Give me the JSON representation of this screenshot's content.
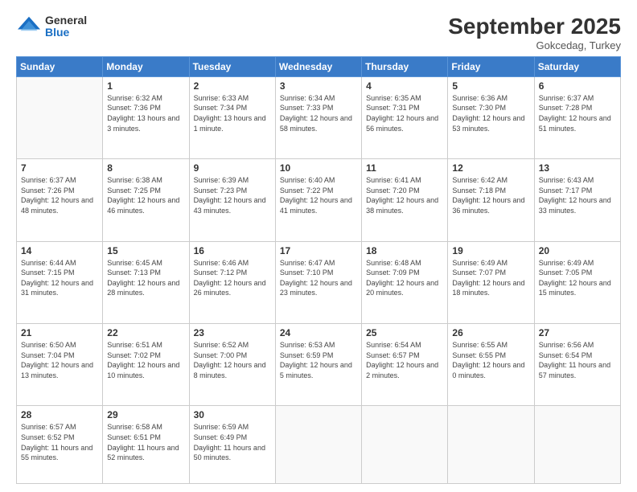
{
  "header": {
    "logo_general": "General",
    "logo_blue": "Blue",
    "month_title": "September 2025",
    "location": "Gokcedag, Turkey"
  },
  "weekdays": [
    "Sunday",
    "Monday",
    "Tuesday",
    "Wednesday",
    "Thursday",
    "Friday",
    "Saturday"
  ],
  "weeks": [
    [
      {
        "day": "",
        "sunrise": "",
        "sunset": "",
        "daylight": ""
      },
      {
        "day": "1",
        "sunrise": "Sunrise: 6:32 AM",
        "sunset": "Sunset: 7:36 PM",
        "daylight": "Daylight: 13 hours and 3 minutes."
      },
      {
        "day": "2",
        "sunrise": "Sunrise: 6:33 AM",
        "sunset": "Sunset: 7:34 PM",
        "daylight": "Daylight: 13 hours and 1 minute."
      },
      {
        "day": "3",
        "sunrise": "Sunrise: 6:34 AM",
        "sunset": "Sunset: 7:33 PM",
        "daylight": "Daylight: 12 hours and 58 minutes."
      },
      {
        "day": "4",
        "sunrise": "Sunrise: 6:35 AM",
        "sunset": "Sunset: 7:31 PM",
        "daylight": "Daylight: 12 hours and 56 minutes."
      },
      {
        "day": "5",
        "sunrise": "Sunrise: 6:36 AM",
        "sunset": "Sunset: 7:30 PM",
        "daylight": "Daylight: 12 hours and 53 minutes."
      },
      {
        "day": "6",
        "sunrise": "Sunrise: 6:37 AM",
        "sunset": "Sunset: 7:28 PM",
        "daylight": "Daylight: 12 hours and 51 minutes."
      }
    ],
    [
      {
        "day": "7",
        "sunrise": "Sunrise: 6:37 AM",
        "sunset": "Sunset: 7:26 PM",
        "daylight": "Daylight: 12 hours and 48 minutes."
      },
      {
        "day": "8",
        "sunrise": "Sunrise: 6:38 AM",
        "sunset": "Sunset: 7:25 PM",
        "daylight": "Daylight: 12 hours and 46 minutes."
      },
      {
        "day": "9",
        "sunrise": "Sunrise: 6:39 AM",
        "sunset": "Sunset: 7:23 PM",
        "daylight": "Daylight: 12 hours and 43 minutes."
      },
      {
        "day": "10",
        "sunrise": "Sunrise: 6:40 AM",
        "sunset": "Sunset: 7:22 PM",
        "daylight": "Daylight: 12 hours and 41 minutes."
      },
      {
        "day": "11",
        "sunrise": "Sunrise: 6:41 AM",
        "sunset": "Sunset: 7:20 PM",
        "daylight": "Daylight: 12 hours and 38 minutes."
      },
      {
        "day": "12",
        "sunrise": "Sunrise: 6:42 AM",
        "sunset": "Sunset: 7:18 PM",
        "daylight": "Daylight: 12 hours and 36 minutes."
      },
      {
        "day": "13",
        "sunrise": "Sunrise: 6:43 AM",
        "sunset": "Sunset: 7:17 PM",
        "daylight": "Daylight: 12 hours and 33 minutes."
      }
    ],
    [
      {
        "day": "14",
        "sunrise": "Sunrise: 6:44 AM",
        "sunset": "Sunset: 7:15 PM",
        "daylight": "Daylight: 12 hours and 31 minutes."
      },
      {
        "day": "15",
        "sunrise": "Sunrise: 6:45 AM",
        "sunset": "Sunset: 7:13 PM",
        "daylight": "Daylight: 12 hours and 28 minutes."
      },
      {
        "day": "16",
        "sunrise": "Sunrise: 6:46 AM",
        "sunset": "Sunset: 7:12 PM",
        "daylight": "Daylight: 12 hours and 26 minutes."
      },
      {
        "day": "17",
        "sunrise": "Sunrise: 6:47 AM",
        "sunset": "Sunset: 7:10 PM",
        "daylight": "Daylight: 12 hours and 23 minutes."
      },
      {
        "day": "18",
        "sunrise": "Sunrise: 6:48 AM",
        "sunset": "Sunset: 7:09 PM",
        "daylight": "Daylight: 12 hours and 20 minutes."
      },
      {
        "day": "19",
        "sunrise": "Sunrise: 6:49 AM",
        "sunset": "Sunset: 7:07 PM",
        "daylight": "Daylight: 12 hours and 18 minutes."
      },
      {
        "day": "20",
        "sunrise": "Sunrise: 6:49 AM",
        "sunset": "Sunset: 7:05 PM",
        "daylight": "Daylight: 12 hours and 15 minutes."
      }
    ],
    [
      {
        "day": "21",
        "sunrise": "Sunrise: 6:50 AM",
        "sunset": "Sunset: 7:04 PM",
        "daylight": "Daylight: 12 hours and 13 minutes."
      },
      {
        "day": "22",
        "sunrise": "Sunrise: 6:51 AM",
        "sunset": "Sunset: 7:02 PM",
        "daylight": "Daylight: 12 hours and 10 minutes."
      },
      {
        "day": "23",
        "sunrise": "Sunrise: 6:52 AM",
        "sunset": "Sunset: 7:00 PM",
        "daylight": "Daylight: 12 hours and 8 minutes."
      },
      {
        "day": "24",
        "sunrise": "Sunrise: 6:53 AM",
        "sunset": "Sunset: 6:59 PM",
        "daylight": "Daylight: 12 hours and 5 minutes."
      },
      {
        "day": "25",
        "sunrise": "Sunrise: 6:54 AM",
        "sunset": "Sunset: 6:57 PM",
        "daylight": "Daylight: 12 hours and 2 minutes."
      },
      {
        "day": "26",
        "sunrise": "Sunrise: 6:55 AM",
        "sunset": "Sunset: 6:55 PM",
        "daylight": "Daylight: 12 hours and 0 minutes."
      },
      {
        "day": "27",
        "sunrise": "Sunrise: 6:56 AM",
        "sunset": "Sunset: 6:54 PM",
        "daylight": "Daylight: 11 hours and 57 minutes."
      }
    ],
    [
      {
        "day": "28",
        "sunrise": "Sunrise: 6:57 AM",
        "sunset": "Sunset: 6:52 PM",
        "daylight": "Daylight: 11 hours and 55 minutes."
      },
      {
        "day": "29",
        "sunrise": "Sunrise: 6:58 AM",
        "sunset": "Sunset: 6:51 PM",
        "daylight": "Daylight: 11 hours and 52 minutes."
      },
      {
        "day": "30",
        "sunrise": "Sunrise: 6:59 AM",
        "sunset": "Sunset: 6:49 PM",
        "daylight": "Daylight: 11 hours and 50 minutes."
      },
      {
        "day": "",
        "sunrise": "",
        "sunset": "",
        "daylight": ""
      },
      {
        "day": "",
        "sunrise": "",
        "sunset": "",
        "daylight": ""
      },
      {
        "day": "",
        "sunrise": "",
        "sunset": "",
        "daylight": ""
      },
      {
        "day": "",
        "sunrise": "",
        "sunset": "",
        "daylight": ""
      }
    ]
  ]
}
